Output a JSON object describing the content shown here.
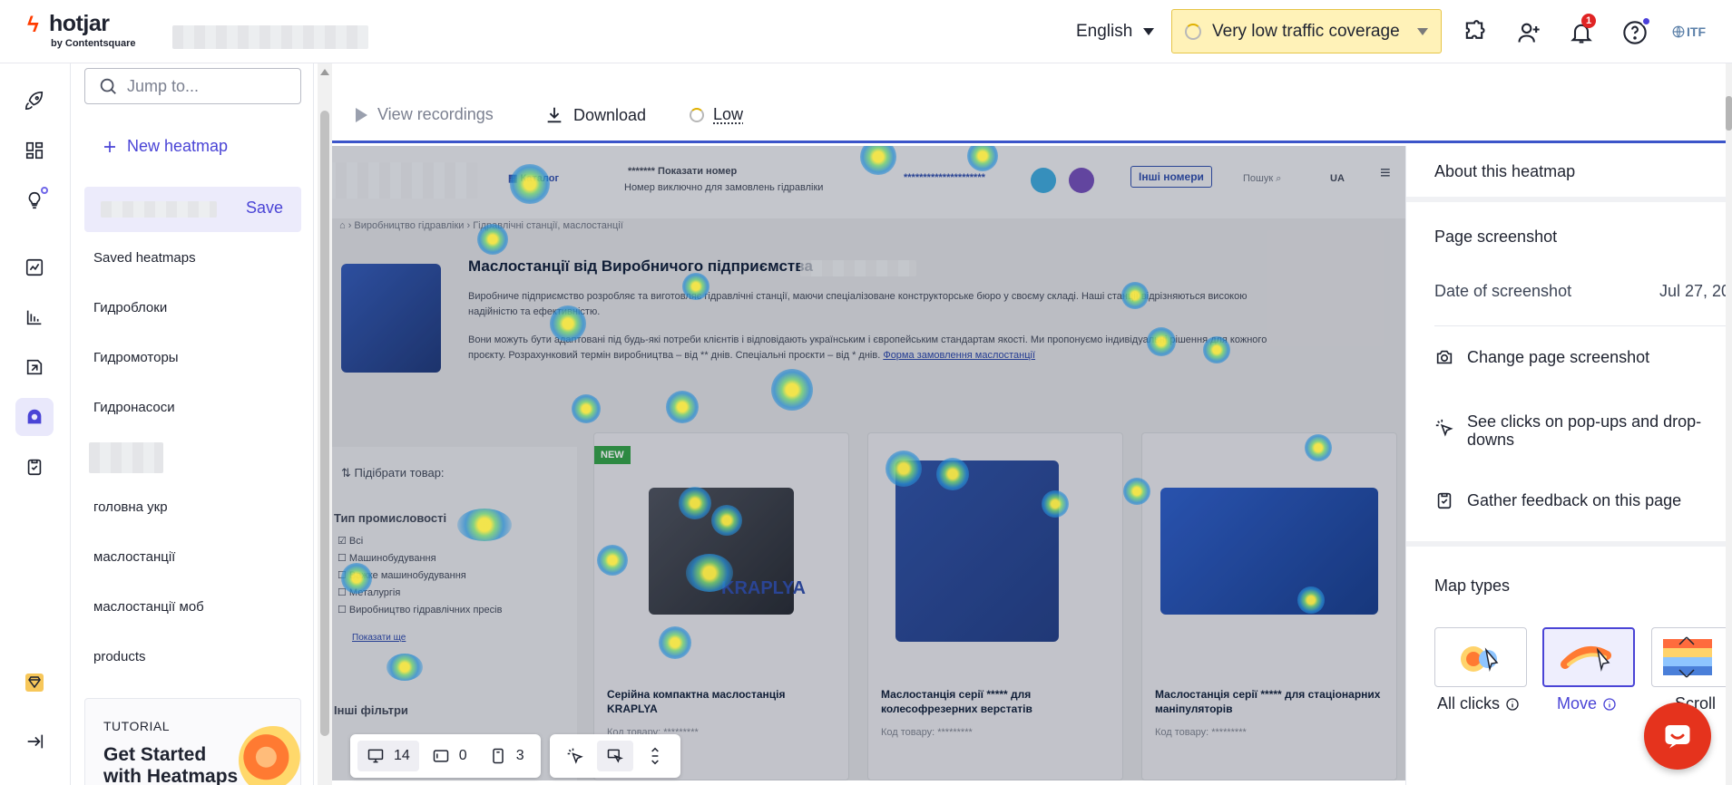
{
  "header": {
    "logo_name": "hotjar",
    "logo_sub": "by Contentsquare",
    "language": "English",
    "traffic_label": "Very low traffic coverage",
    "notification_count": "1",
    "org_label": "ITF"
  },
  "sidebar": {
    "search_placeholder": "Jump to...",
    "new_heatmap": "New heatmap",
    "save_label": "Save",
    "section_saved": "Saved heatmaps",
    "items": [
      "Гидроблоки",
      "Гидромоторы",
      "Гидронасоси",
      "головна укр",
      "маслостанції",
      "маслостанції моб",
      "products"
    ],
    "tutorial": {
      "label": "TUTORIAL",
      "title": "Get Started with Heatmaps"
    }
  },
  "toolbar": {
    "view_recordings": "View recordings",
    "download": "Download",
    "low": "Low"
  },
  "site": {
    "catalog": "Каталог",
    "show_number": "Показати номер",
    "number_note": "Номер виключно для замовлень гідравліки",
    "other_numbers": "Інші номери",
    "search": "Пошук",
    "lang": "UA",
    "breadcrumb_1": "Виробництво гідравліки",
    "breadcrumb_2": "Гідравлічні станції, маслостанції",
    "title": "Маслостанції від Виробничого підприємства",
    "para_1": "Виробниче підприємство розробляє та виготовляє гідравлічні станції, маючи спеціалізоване конструкторське бюро у своєму складі. Наші станції відрізняються високою надійністю та ефективністю.",
    "para_2a": "Вони можуть бути адаптовані під будь-які потреби клієнтів і відповідають українським і європейським стандартам якості. Ми пропонуємо індивідуальні рішення для кожного проєкту. Розрахунковий термін виробництва – від ** днів. Спеціальні проєкти – від * днів.",
    "para_2_link": "Форма замовлення маслостанції",
    "filter_title": "Підібрати товар:",
    "filter_group": "Тип промисловості",
    "filter_options": [
      "Всі",
      "Машинобудування",
      "Важке машинобудування",
      "Металургія",
      "Виробництво гідравлічних пресів"
    ],
    "filter_more": "Показати ще",
    "filter_group_2": "Інші фільтри",
    "new_tag": "NEW",
    "brand": "KRAPLYA",
    "card_1": "Серійна компактна маслостанція KRAPLYA",
    "card_2": "Маслостанція серії ***** для колесофрезерних верстатів",
    "card_3": "Маслостанція серії ***** для стаціонарних маніпуляторів",
    "code_1": "Код товару: *********",
    "code_2": "Код товару: *********",
    "code_3": "Код товару: *********"
  },
  "dock": {
    "desktop_count": "14",
    "tablet_count": "0",
    "mobile_count": "3"
  },
  "panel": {
    "title": "About this heatmap",
    "page_screenshot": "Page screenshot",
    "date_label": "Date of screenshot",
    "date_value": "Jul 27, 20",
    "change_screenshot": "Change page screenshot",
    "see_clicks": "See clicks on pop-ups and drop-downs",
    "gather_feedback": "Gather feedback on this page",
    "map_types": "Map types",
    "map_all_clicks": "All clicks",
    "map_move": "Move",
    "map_scroll": "Scroll"
  },
  "colors": {
    "accent": "#4a44d6",
    "hotjar_red": "#ff3c00",
    "warning_bg": "#fff2b8",
    "chat_red": "#e5331d"
  }
}
